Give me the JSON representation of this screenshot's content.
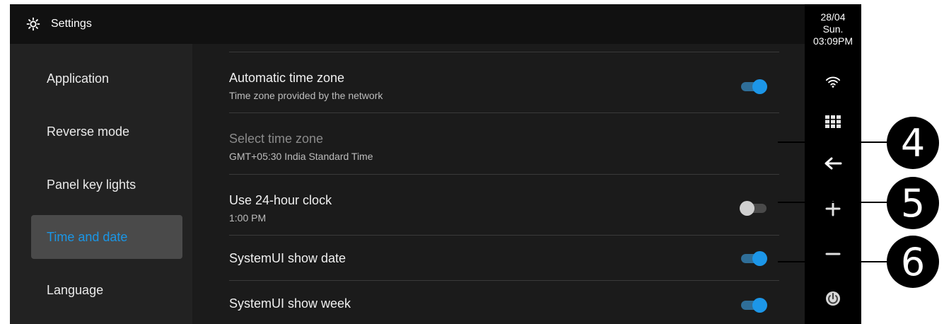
{
  "header": {
    "title": "Settings",
    "icon": "gear-icon"
  },
  "sidebar": {
    "items": [
      {
        "label": "Application",
        "active": false
      },
      {
        "label": "Reverse mode",
        "active": false
      },
      {
        "label": "Panel key lights",
        "active": false
      },
      {
        "label": "Time and date",
        "active": true
      },
      {
        "label": "Language",
        "active": false
      }
    ]
  },
  "settings": {
    "rows": [
      {
        "title": "Automatic time zone",
        "subtitle": "Time zone provided by the network",
        "toggle": "on"
      },
      {
        "title": "Select time zone",
        "subtitle": "GMT+05:30 India Standard Time",
        "disabled": true
      },
      {
        "title": "Use 24-hour clock",
        "subtitle": "1:00 PM",
        "toggle": "off"
      },
      {
        "title": "SystemUI show date",
        "toggle": "on"
      },
      {
        "title": "SystemUI show week",
        "toggle": "on"
      }
    ]
  },
  "rail": {
    "date": "28/04",
    "day": "Sun.",
    "time": "03:09PM",
    "icons": [
      "wifi-icon",
      "apps-grid-icon",
      "back-arrow-icon",
      "plus-icon",
      "minus-icon",
      "power-icon"
    ]
  },
  "callouts": [
    "4",
    "5",
    "6"
  ],
  "colors": {
    "accent": "#1c96e8",
    "background": "#1b1b1b",
    "sidebar": "#222222",
    "topbar": "#111111"
  }
}
